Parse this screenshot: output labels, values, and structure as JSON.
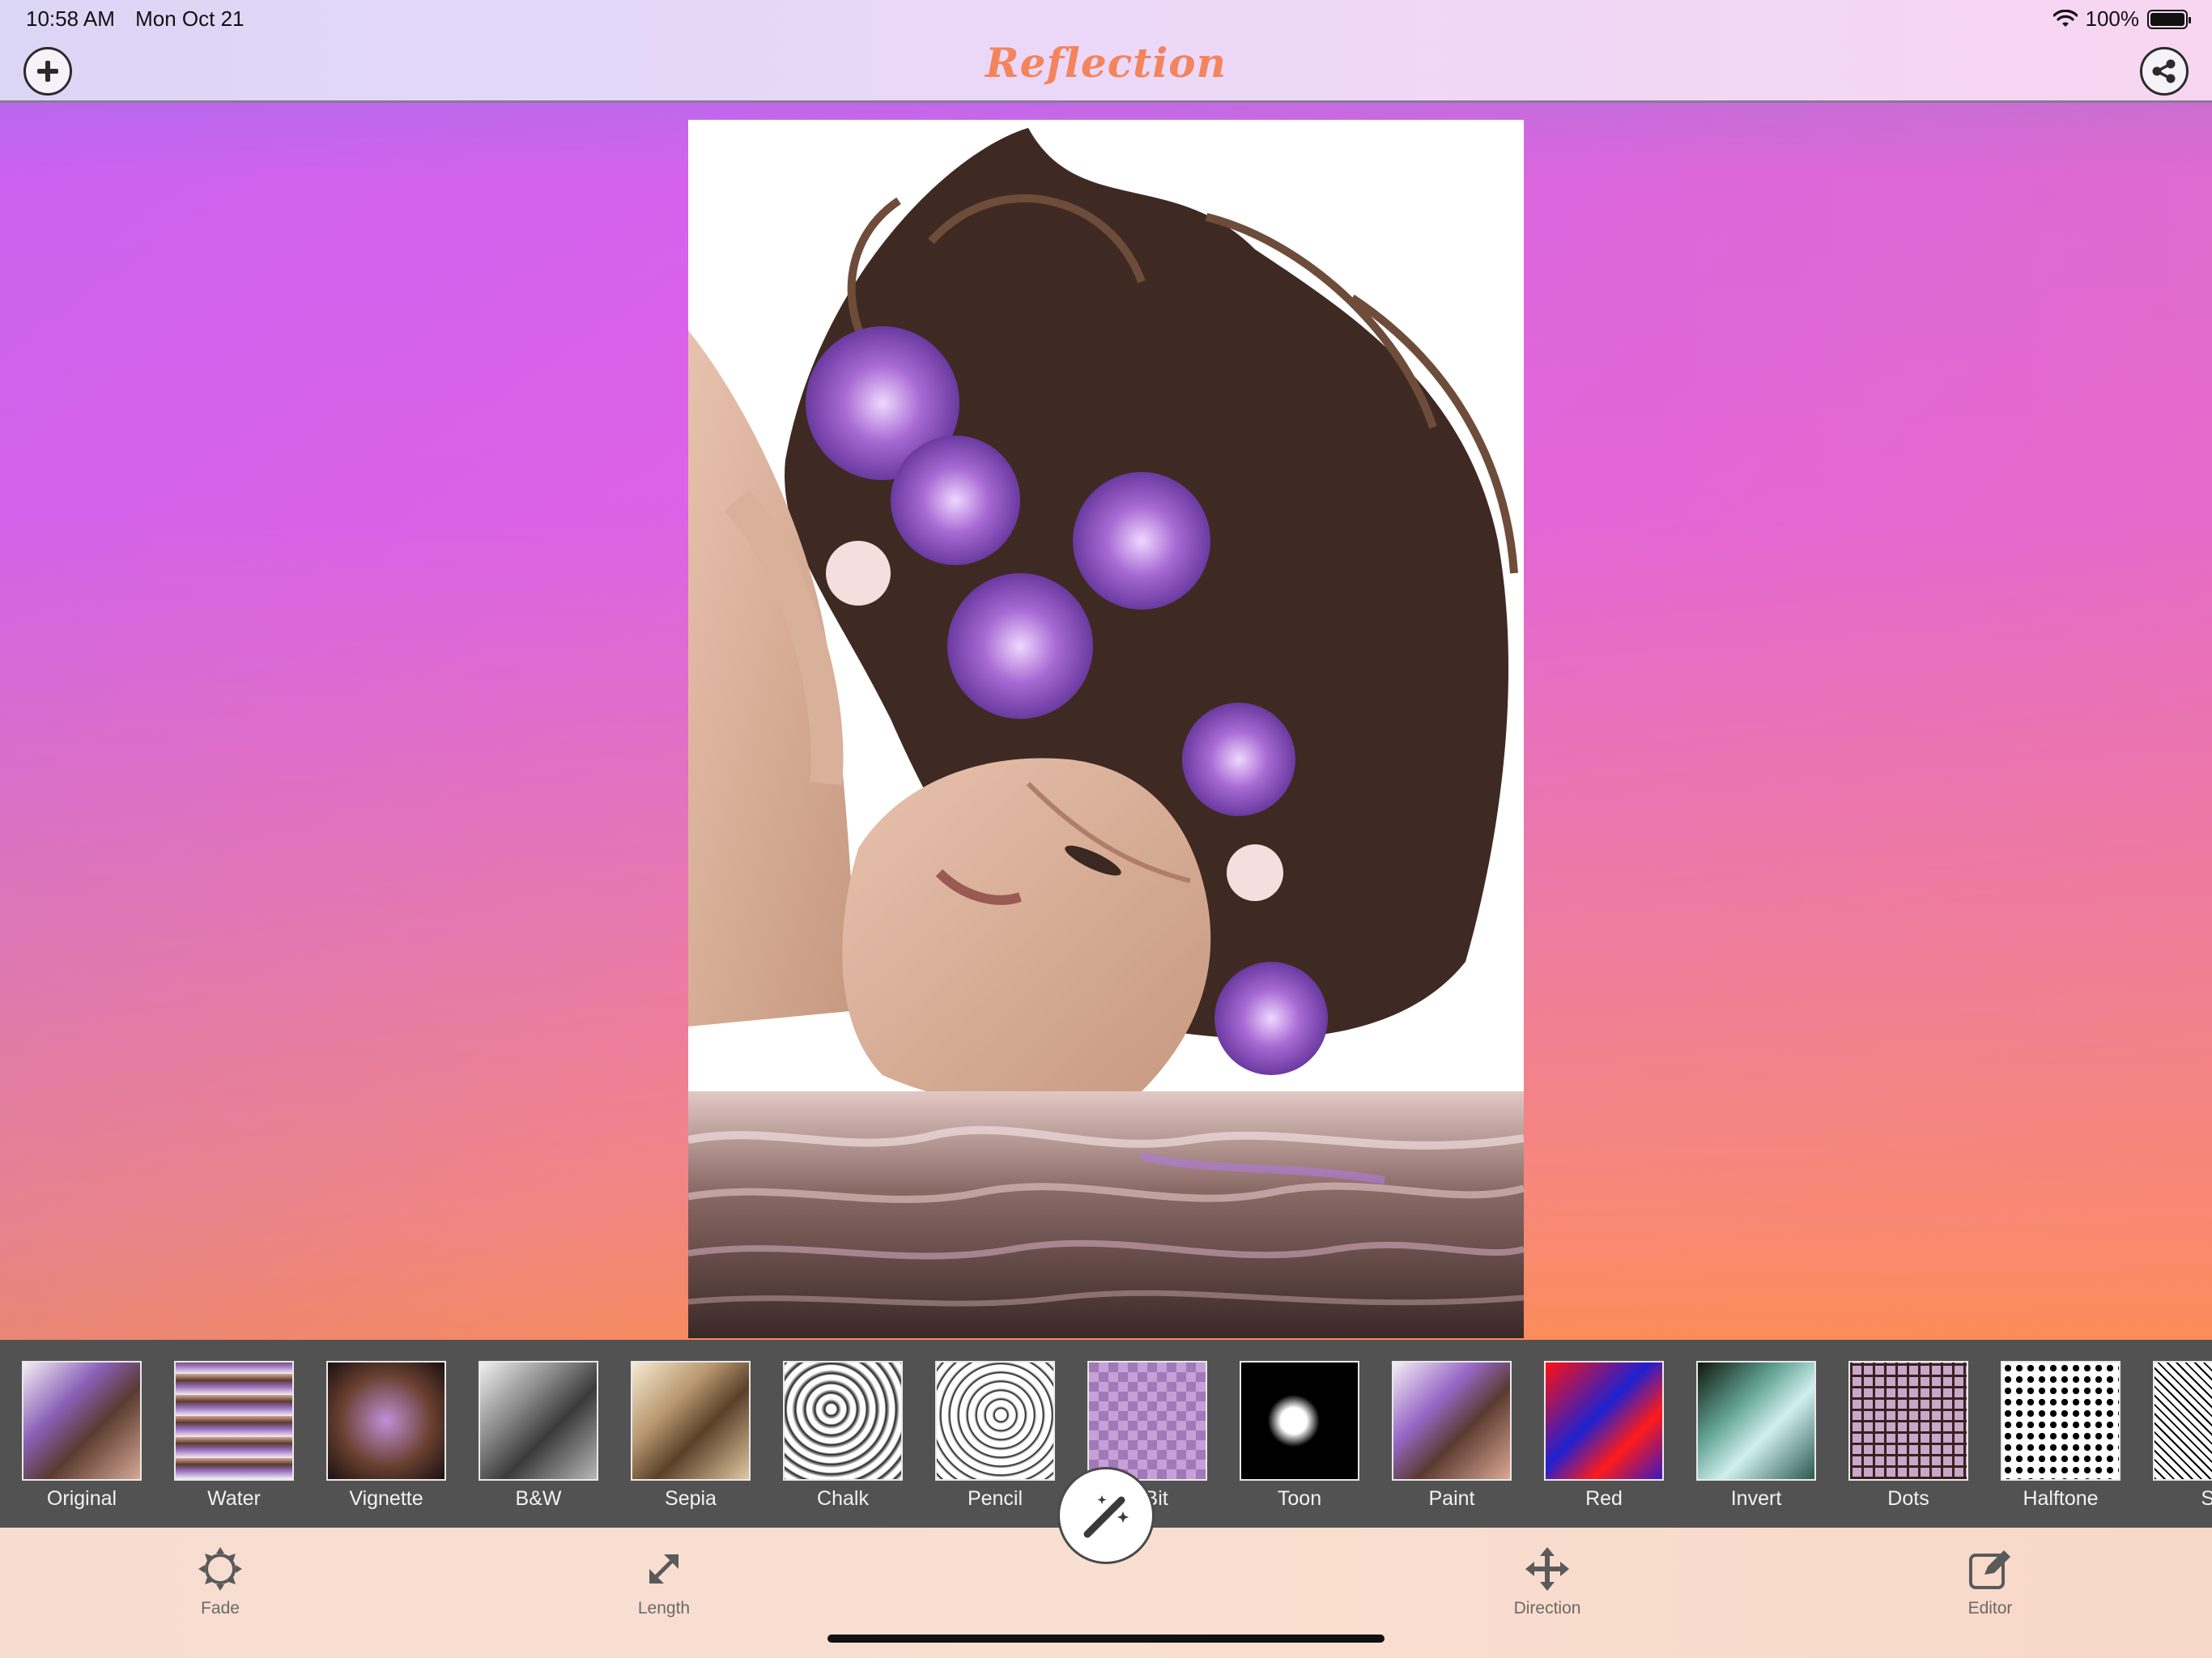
{
  "status_bar": {
    "time": "10:58 AM",
    "date": "Mon Oct 21",
    "battery": "100%",
    "wifi_icon": "wifi-icon",
    "battery_icon": "battery-full-icon"
  },
  "header": {
    "title": "Reflection",
    "add_icon": "plus-circle-icon",
    "share_icon": "share-icon"
  },
  "photo": {
    "description_icon": "edited-photo",
    "effect": "water reflection"
  },
  "filters": [
    {
      "label": "Original"
    },
    {
      "label": "Water"
    },
    {
      "label": "Vignette"
    },
    {
      "label": "B&W"
    },
    {
      "label": "Sepia"
    },
    {
      "label": "Chalk"
    },
    {
      "label": "Pencil"
    },
    {
      "label": "8-Bit"
    },
    {
      "label": "Toon"
    },
    {
      "label": "Paint"
    },
    {
      "label": "Red"
    },
    {
      "label": "Invert"
    },
    {
      "label": "Dots"
    },
    {
      "label": "Halftone"
    },
    {
      "label": "Sc"
    }
  ],
  "toolbar": {
    "fade_label": "Fade",
    "length_label": "Length",
    "direction_label": "Direction",
    "editor_label": "Editor",
    "magic_icon": "magic-wand-icon"
  },
  "colors": {
    "title": "#f3845c",
    "strip": "#525252",
    "toolbar_bg": "#f8ddd0"
  }
}
